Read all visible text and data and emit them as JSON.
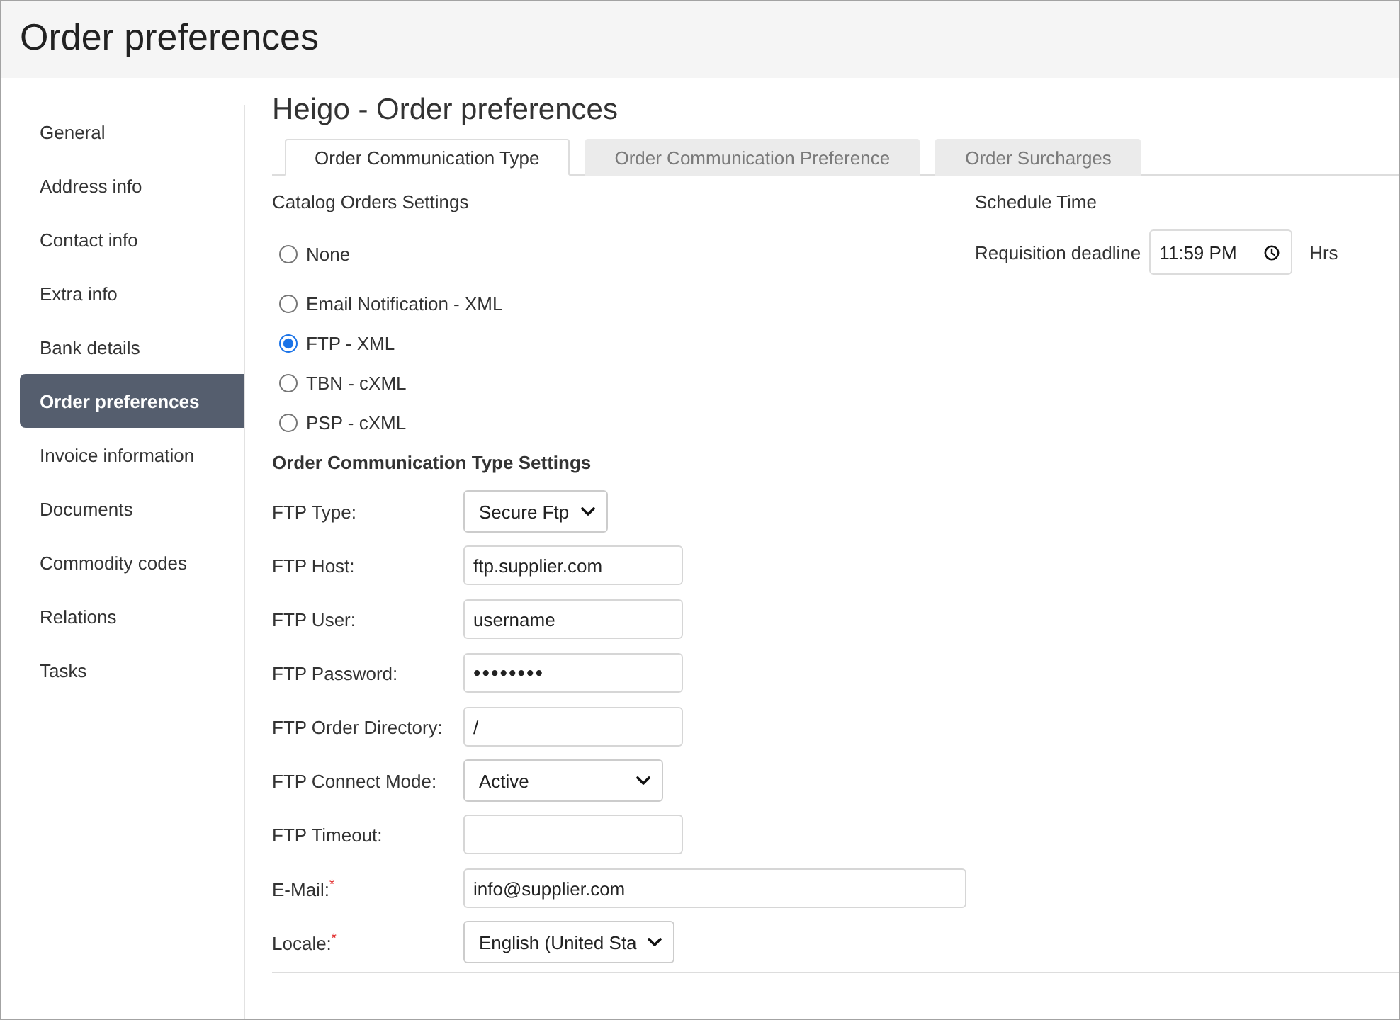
{
  "window": {
    "title": "Order preferences"
  },
  "sidebar": {
    "items": [
      {
        "label": "General",
        "selected": false
      },
      {
        "label": "Address info",
        "selected": false
      },
      {
        "label": "Contact info",
        "selected": false
      },
      {
        "label": "Extra info",
        "selected": false
      },
      {
        "label": "Bank details",
        "selected": false
      },
      {
        "label": "Order preferences",
        "selected": true
      },
      {
        "label": "Invoice information",
        "selected": false
      },
      {
        "label": "Documents",
        "selected": false
      },
      {
        "label": "Commodity codes",
        "selected": false
      },
      {
        "label": "Relations",
        "selected": false
      },
      {
        "label": "Tasks",
        "selected": false
      }
    ]
  },
  "content": {
    "title": "Heigo - Order preferences",
    "tabs": [
      {
        "label": "Order Communication Type",
        "selected": true
      },
      {
        "label": "Order Communication Preference",
        "selected": false
      },
      {
        "label": "Order Surcharges",
        "selected": false
      }
    ],
    "catalog_orders": {
      "heading": "Catalog Orders Settings",
      "options": [
        {
          "label": "None",
          "selected": false
        },
        {
          "label": "Email Notification - XML",
          "selected": false
        },
        {
          "label": "FTP - XML",
          "selected": true
        },
        {
          "label": "TBN - cXML",
          "selected": false
        },
        {
          "label": "PSP - cXML",
          "selected": false
        }
      ]
    },
    "schedule": {
      "heading": "Schedule Time",
      "label": "Requisition deadline",
      "value": "11:59 PM",
      "unit": "Hrs"
    },
    "settings": {
      "heading": "Order Communication Type Settings",
      "fields": [
        {
          "label": "FTP Type:",
          "kind": "select",
          "value": "Secure Ftp"
        },
        {
          "label": "FTP Host:",
          "kind": "input",
          "value": "ftp.supplier.com"
        },
        {
          "label": "FTP User:",
          "kind": "input",
          "value": "username"
        },
        {
          "label": "FTP Password:",
          "kind": "password",
          "value": "••••••••"
        },
        {
          "label": "FTP Order Directory:",
          "kind": "input",
          "value": "/"
        },
        {
          "label": "FTP Connect Mode:",
          "kind": "select",
          "value": "Active"
        },
        {
          "label": "FTP Timeout:",
          "kind": "input"
        },
        {
          "label": "E-Mail:$^{*}$",
          "kind": "input",
          "value": "info@supplier.com"
        },
        {
          "label": "Locale:$^{*}$",
          "kind": "select",
          "value": "English (United Sta"
        }
      ]
    }
  }
}
